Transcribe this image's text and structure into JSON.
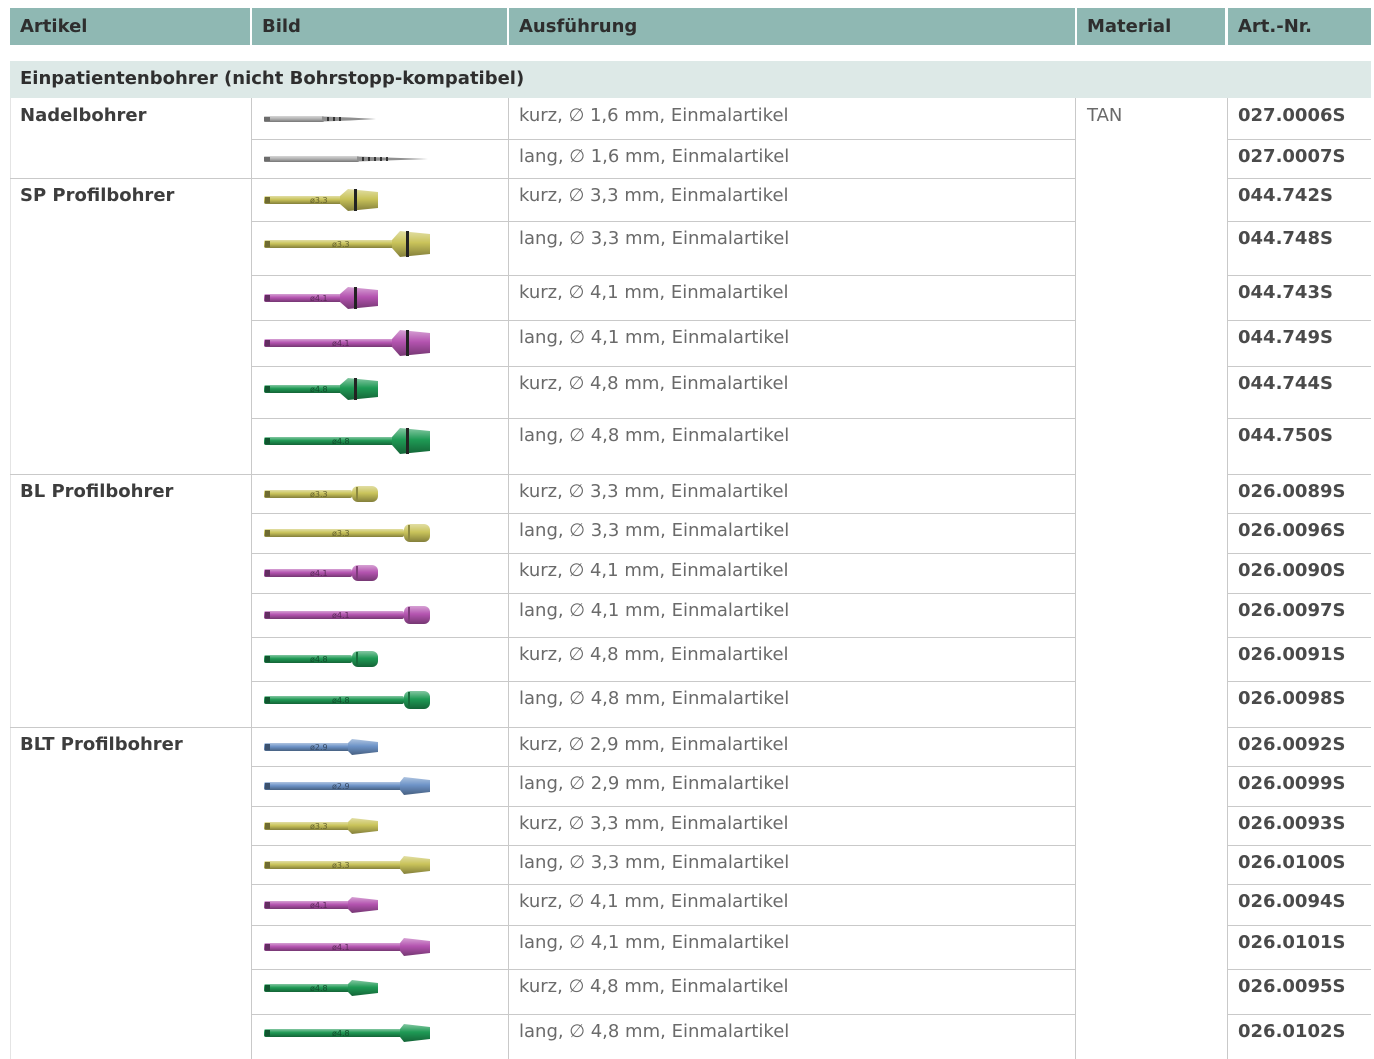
{
  "header": {
    "artikel": "Artikel",
    "bild": "Bild",
    "ausfuehrung": "Ausführung",
    "material": "Material",
    "artnr": "Art.-Nr."
  },
  "section_title": "Einpatientenbohrer (nicht Bohrstopp-kompatibel)",
  "material_value": "TAN",
  "groups": [
    {
      "name": "Nadelbohrer"
    },
    {
      "name": "SP Profilbohrer"
    },
    {
      "name": "BL Profilbohrer"
    },
    {
      "name": "BLT Profilbohrer"
    }
  ],
  "rows": [
    {
      "desc": "kurz, ∅ 1,6 mm, Einmalartikel",
      "nr": "027.0006S",
      "drill": {
        "color": "#b4b4b4",
        "type": "needle",
        "length": "short",
        "label": "ø1.6"
      }
    },
    {
      "desc": "lang, ∅ 1,6 mm, Einmalartikel",
      "nr": "027.0007S",
      "drill": {
        "color": "#b4b4b4",
        "type": "needle",
        "length": "long",
        "label": "ø1.6"
      }
    },
    {
      "desc": "kurz, ∅ 3,3 mm, Einmalartikel",
      "nr": "044.742S",
      "drill": {
        "color": "#c9c35a",
        "type": "sp",
        "length": "short",
        "label": "ø3.3"
      }
    },
    {
      "desc": "lang, ∅ 3,3 mm, Einmalartikel",
      "nr": "044.748S",
      "drill": {
        "color": "#c9c35a",
        "type": "sp",
        "length": "long",
        "label": "ø3.3"
      }
    },
    {
      "desc": "kurz, ∅ 4,1 mm, Einmalartikel",
      "nr": "044.743S",
      "drill": {
        "color": "#b454b0",
        "type": "sp",
        "length": "short",
        "label": "ø4.1"
      }
    },
    {
      "desc": "lang, ∅ 4,1 mm, Einmalartikel",
      "nr": "044.749S",
      "drill": {
        "color": "#b454b0",
        "type": "sp",
        "length": "long",
        "label": "ø4.1"
      }
    },
    {
      "desc": "kurz, ∅ 4,8 mm, Einmalartikel",
      "nr": "044.744S",
      "drill": {
        "color": "#1f9a55",
        "type": "sp",
        "length": "short",
        "label": "ø4.8"
      }
    },
    {
      "desc": "lang, ∅ 4,8 mm, Einmalartikel",
      "nr": "044.750S",
      "drill": {
        "color": "#1f9a55",
        "type": "sp",
        "length": "long",
        "label": "ø4.8"
      }
    },
    {
      "desc": "kurz, ∅ 3,3 mm, Einmalartikel",
      "nr": "026.0089S",
      "drill": {
        "color": "#c9c35a",
        "type": "bl",
        "length": "short",
        "label": "ø3.3"
      }
    },
    {
      "desc": "lang, ∅ 3,3 mm, Einmalartikel",
      "nr": "026.0096S",
      "drill": {
        "color": "#c9c35a",
        "type": "bl",
        "length": "long",
        "label": "ø3.3"
      }
    },
    {
      "desc": "kurz, ∅ 4,1 mm, Einmalartikel",
      "nr": "026.0090S",
      "drill": {
        "color": "#b454b0",
        "type": "bl",
        "length": "short",
        "label": "ø4.1"
      }
    },
    {
      "desc": "lang, ∅ 4,1 mm, Einmalartikel",
      "nr": "026.0097S",
      "drill": {
        "color": "#b454b0",
        "type": "bl",
        "length": "long",
        "label": "ø4.1"
      }
    },
    {
      "desc": "kurz, ∅ 4,8 mm, Einmalartikel",
      "nr": "026.0091S",
      "drill": {
        "color": "#1f9a55",
        "type": "bl",
        "length": "short",
        "label": "ø4.8"
      }
    },
    {
      "desc": "lang, ∅ 4,8 mm, Einmalartikel",
      "nr": "026.0098S",
      "drill": {
        "color": "#1f9a55",
        "type": "bl",
        "length": "long",
        "label": "ø4.8"
      }
    },
    {
      "desc": "kurz, ∅ 2,9 mm, Einmalartikel",
      "nr": "026.0092S",
      "drill": {
        "color": "#6d93c7",
        "type": "blt",
        "length": "short",
        "label": "ø2.9"
      }
    },
    {
      "desc": "lang, ∅ 2,9 mm, Einmalartikel",
      "nr": "026.0099S",
      "drill": {
        "color": "#6d93c7",
        "type": "blt",
        "length": "long",
        "label": "ø2.9"
      }
    },
    {
      "desc": "kurz, ∅ 3,3 mm, Einmalartikel",
      "nr": "026.0093S",
      "drill": {
        "color": "#c9c35a",
        "type": "blt",
        "length": "short",
        "label": "ø3.3"
      }
    },
    {
      "desc": "lang, ∅ 3,3 mm, Einmalartikel",
      "nr": "026.0100S",
      "drill": {
        "color": "#c9c35a",
        "type": "blt",
        "length": "long",
        "label": "ø3.3"
      }
    },
    {
      "desc": "kurz, ∅ 4,1 mm, Einmalartikel",
      "nr": "026.0094S",
      "drill": {
        "color": "#b454b0",
        "type": "blt",
        "length": "short",
        "label": "ø4.1"
      }
    },
    {
      "desc": "lang, ∅ 4,1 mm, Einmalartikel",
      "nr": "026.0101S",
      "drill": {
        "color": "#b454b0",
        "type": "blt",
        "length": "long",
        "label": "ø4.1"
      }
    },
    {
      "desc": "kurz, ∅ 4,8 mm, Einmalartikel",
      "nr": "026.0095S",
      "drill": {
        "color": "#1f9a55",
        "type": "blt",
        "length": "short",
        "label": "ø4.8"
      }
    },
    {
      "desc": "lang, ∅ 4,8 mm, Einmalartikel",
      "nr": "026.0102S",
      "drill": {
        "color": "#1f9a55",
        "type": "blt",
        "length": "long",
        "label": "ø4.8"
      }
    }
  ]
}
